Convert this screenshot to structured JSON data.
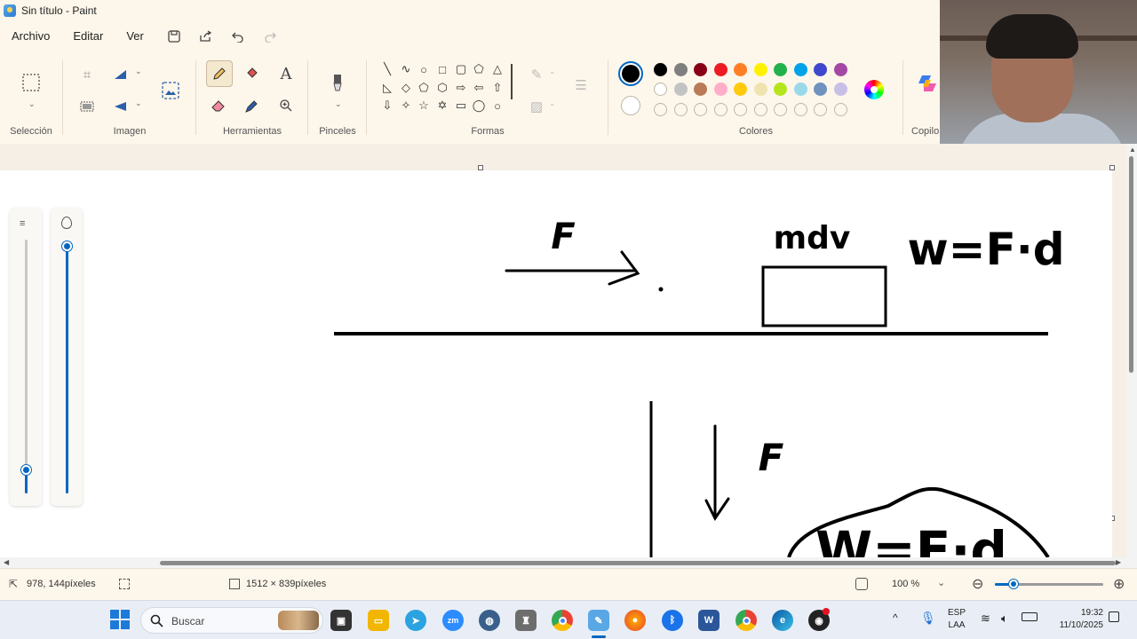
{
  "window": {
    "title": "Sin título - Paint"
  },
  "menu": {
    "items": [
      "Archivo",
      "Editar",
      "Ver"
    ]
  },
  "ribbon": {
    "groups": {
      "seleccion": "Selección",
      "imagen": "Imagen",
      "herramientas": "Herramientas",
      "pinceles": "Pinceles",
      "formas": "Formas",
      "colores": "Colores",
      "copilot": "Copilo"
    },
    "text_tool_glyph": "A",
    "current_colors": {
      "primary": "#000000",
      "secondary": "#ffffff"
    },
    "palette_row1": [
      "#000000",
      "#7f7f7f",
      "#880015",
      "#ed1c24",
      "#ff7f27",
      "#fff200",
      "#22b14c",
      "#00a2e8",
      "#3f48cc",
      "#a349a4"
    ],
    "palette_row2": [
      "#ffffff",
      "#c3c3c3",
      "#b97a57",
      "#ffaec9",
      "#ffc90e",
      "#efe4b0",
      "#b5e61d",
      "#99d9ea",
      "#7092be",
      "#c8bfe7"
    ]
  },
  "canvas_drawing": {
    "text_force_top": "F",
    "text_mdv": "mdv",
    "text_formula_top": "w=F·d",
    "text_force_bottom": "F",
    "text_formula_bottom": "W=F·d"
  },
  "status": {
    "cursor_position": "978, 144píxeles",
    "canvas_size": "1512 × 839píxeles",
    "zoom": "100 %",
    "zoom_level_fraction": 0.18
  },
  "taskbar": {
    "search_placeholder": "Buscar",
    "input_language": "ESP",
    "keyboard_layout": "LAA",
    "time": "19:32",
    "date": "11/10/2025"
  }
}
